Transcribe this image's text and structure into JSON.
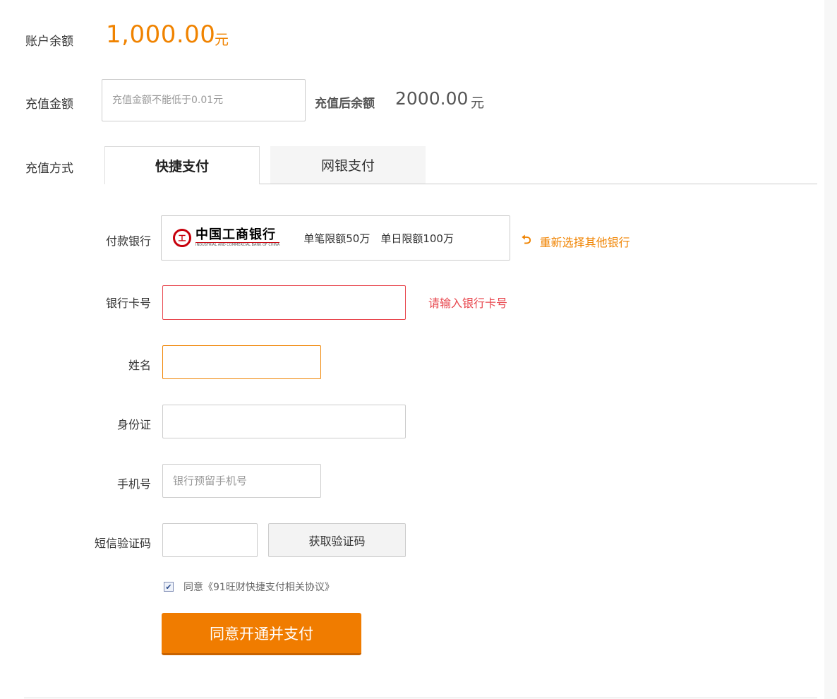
{
  "balance": {
    "label": "账户余额",
    "amount": "1,000.00",
    "unit": "元"
  },
  "recharge": {
    "label": "充值金额",
    "placeholder": "充值金额不能低于0.01元",
    "after_label": "充值后余额",
    "after_amount": "2000.00",
    "after_unit": "元"
  },
  "method": {
    "label": "充值方式",
    "tabs": [
      {
        "label": "快捷支付",
        "active": true
      },
      {
        "label": "网银支付",
        "active": false
      }
    ]
  },
  "form": {
    "bank": {
      "label": "付款银行",
      "name": "中国工商银行",
      "name_en": "INDUSTRIAL AND COMMERCIAL BANK OF CHINA",
      "logo_text": "工",
      "limits": "单笔限额50万　单日限额100万",
      "reselect": "重新选择其他银行",
      "reselect_icon": "undo-arrow-icon"
    },
    "card": {
      "label": "银行卡号",
      "value": "",
      "error": "请输入银行卡号"
    },
    "name": {
      "label": "姓名",
      "value": ""
    },
    "id": {
      "label": "身份证",
      "value": ""
    },
    "phone": {
      "label": "手机号",
      "placeholder": "银行预留手机号"
    },
    "sms": {
      "label": "短信验证码",
      "value": "",
      "button": "获取验证码"
    },
    "agree": {
      "checked": true,
      "text": "同意《91旺财快捷支付相关协议》"
    },
    "submit": "同意开通并支付"
  },
  "colors": {
    "accent": "#f08300",
    "error": "#e8474e",
    "button": "#f07c00"
  }
}
